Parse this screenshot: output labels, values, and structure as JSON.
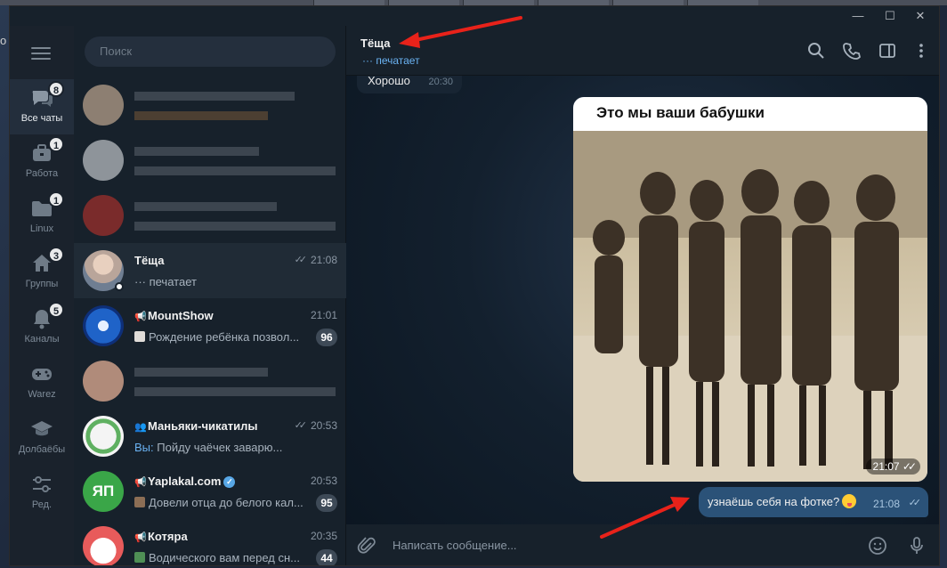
{
  "window": {
    "minimize_glyph": "—",
    "maximize_glyph": "☐",
    "close_glyph": "✕"
  },
  "desktop_edge_text": "о",
  "folders": [
    {
      "label": "Все чаты",
      "badge": "8",
      "icon": "chat-bubbles-icon",
      "active": true
    },
    {
      "label": "Работа",
      "badge": "1",
      "icon": "briefcase-icon"
    },
    {
      "label": "Linux",
      "badge": "1",
      "icon": "folder-icon"
    },
    {
      "label": "Группы",
      "badge": "3",
      "icon": "home-icon"
    },
    {
      "label": "Каналы",
      "badge": "5",
      "icon": "bell-icon"
    },
    {
      "label": "Warez",
      "badge": "",
      "icon": "gamepad-icon"
    },
    {
      "label": "Долбаёбы",
      "badge": "",
      "icon": "graduation-cap-icon"
    },
    {
      "label": "Ред.",
      "badge": "",
      "icon": "sliders-icon"
    }
  ],
  "search": {
    "placeholder": "Поиск"
  },
  "chats": [
    {
      "name": "Тёща",
      "time": "21:08",
      "ticks": "✓✓",
      "message": "··· печатает"
    },
    {
      "name": "MountShow",
      "time": "21:01",
      "message": "Рождение ребёнка позвол...",
      "count": "96"
    },
    {
      "name": "Маньяки-чикатилы",
      "time": "20:53",
      "ticks": "✓✓",
      "sender": "Вы:",
      "message": "Пойду чаёчек заварю..."
    },
    {
      "name": "Yaplakal.com",
      "time": "20:53",
      "message": "Довели отца до белого кал...",
      "count": "95"
    },
    {
      "name": "Котяра",
      "time": "20:35",
      "message": "Водического вам перед сн...",
      "count": "44"
    }
  ],
  "avatar_text": {
    "yaplakal": "ЯП"
  },
  "conversation": {
    "title": "Тёща",
    "status": "··· печатает",
    "old_message": {
      "text": "Хорошо",
      "time": "20:30"
    },
    "photo_message": {
      "caption": "Это мы ваши бабушки",
      "time": "21:07",
      "ticks": "✓✓"
    },
    "text_message": {
      "text": "узнаёшь себя на фотке?",
      "time": "21:08",
      "ticks": "✓✓"
    },
    "composer_placeholder": "Написать сообщение..."
  },
  "colors": {
    "accent": "#6ab2f2",
    "outgoing_bubble": "#2b5278",
    "annotation_arrow": "#e8221a"
  }
}
